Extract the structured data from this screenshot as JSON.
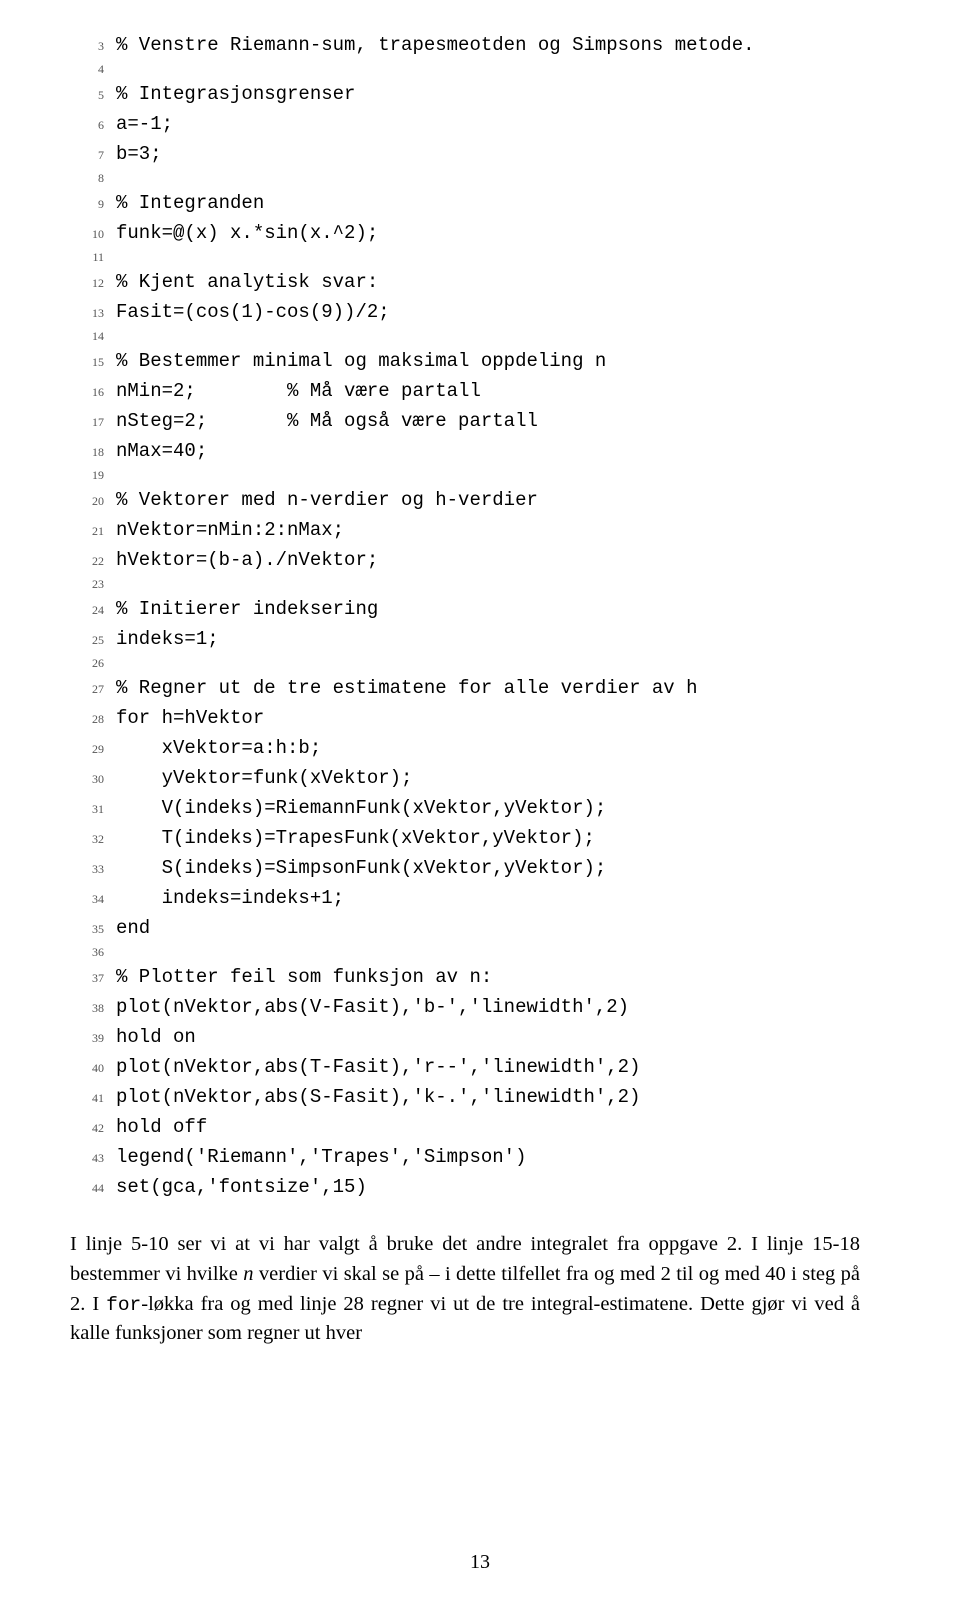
{
  "code": [
    {
      "n": "3",
      "t": "% Venstre Riemann-sum, trapesmeotden og Simpsons metode."
    },
    {
      "n": "4",
      "t": ""
    },
    {
      "n": "5",
      "t": "% Integrasjonsgrenser"
    },
    {
      "n": "6",
      "t": "a=-1;"
    },
    {
      "n": "7",
      "t": "b=3;"
    },
    {
      "n": "8",
      "t": ""
    },
    {
      "n": "9",
      "t": "% Integranden"
    },
    {
      "n": "10",
      "t": "funk=@(x) x.*sin(x.^2);"
    },
    {
      "n": "11",
      "t": ""
    },
    {
      "n": "12",
      "t": "% Kjent analytisk svar:"
    },
    {
      "n": "13",
      "t": "Fasit=(cos(1)-cos(9))/2;"
    },
    {
      "n": "14",
      "t": ""
    },
    {
      "n": "15",
      "t": "% Bestemmer minimal og maksimal oppdeling n"
    },
    {
      "n": "16",
      "t": "nMin=2;        % Må være partall"
    },
    {
      "n": "17",
      "t": "nSteg=2;       % Må også være partall"
    },
    {
      "n": "18",
      "t": "nMax=40;"
    },
    {
      "n": "19",
      "t": ""
    },
    {
      "n": "20",
      "t": "% Vektorer med n-verdier og h-verdier"
    },
    {
      "n": "21",
      "t": "nVektor=nMin:2:nMax;"
    },
    {
      "n": "22",
      "t": "hVektor=(b-a)./nVektor;"
    },
    {
      "n": "23",
      "t": ""
    },
    {
      "n": "24",
      "t": "% Initierer indeksering"
    },
    {
      "n": "25",
      "t": "indeks=1;"
    },
    {
      "n": "26",
      "t": ""
    },
    {
      "n": "27",
      "t": "% Regner ut de tre estimatene for alle verdier av h"
    },
    {
      "n": "28",
      "t": "for h=hVektor"
    },
    {
      "n": "29",
      "t": "    xVektor=a:h:b;"
    },
    {
      "n": "30",
      "t": "    yVektor=funk(xVektor);"
    },
    {
      "n": "31",
      "t": "    V(indeks)=RiemannFunk(xVektor,yVektor);"
    },
    {
      "n": "32",
      "t": "    T(indeks)=TrapesFunk(xVektor,yVektor);"
    },
    {
      "n": "33",
      "t": "    S(indeks)=SimpsonFunk(xVektor,yVektor);"
    },
    {
      "n": "34",
      "t": "    indeks=indeks+1;"
    },
    {
      "n": "35",
      "t": "end"
    },
    {
      "n": "36",
      "t": ""
    },
    {
      "n": "37",
      "t": "% Plotter feil som funksjon av n:"
    },
    {
      "n": "38",
      "t": "plot(nVektor,abs(V-Fasit),'b-','linewidth',2)"
    },
    {
      "n": "39",
      "t": "hold on"
    },
    {
      "n": "40",
      "t": "plot(nVektor,abs(T-Fasit),'r--','linewidth',2)"
    },
    {
      "n": "41",
      "t": "plot(nVektor,abs(S-Fasit),'k-.','linewidth',2)"
    },
    {
      "n": "42",
      "t": "hold off"
    },
    {
      "n": "43",
      "t": "legend('Riemann','Trapes','Simpson')"
    },
    {
      "n": "44",
      "t": "set(gca,'fontsize',15)"
    }
  ],
  "paragraph": {
    "p1a": "I linje 5-10 ser vi at vi har valgt å bruke det andre integralet fra oppgave 2. I linje 15-18 bestemmer vi hvilke ",
    "p1n": "n",
    "p1b": " verdier vi skal se på – i dette tilfellet fra og med 2 til og med 40 i steg på 2. I ",
    "p1for": "for",
    "p1c": "-løkka fra og med linje 28 regner vi ut de tre integral-estimatene. Dette gjør vi ved å kalle funksjoner som regner ut hver"
  },
  "page_number": "13"
}
